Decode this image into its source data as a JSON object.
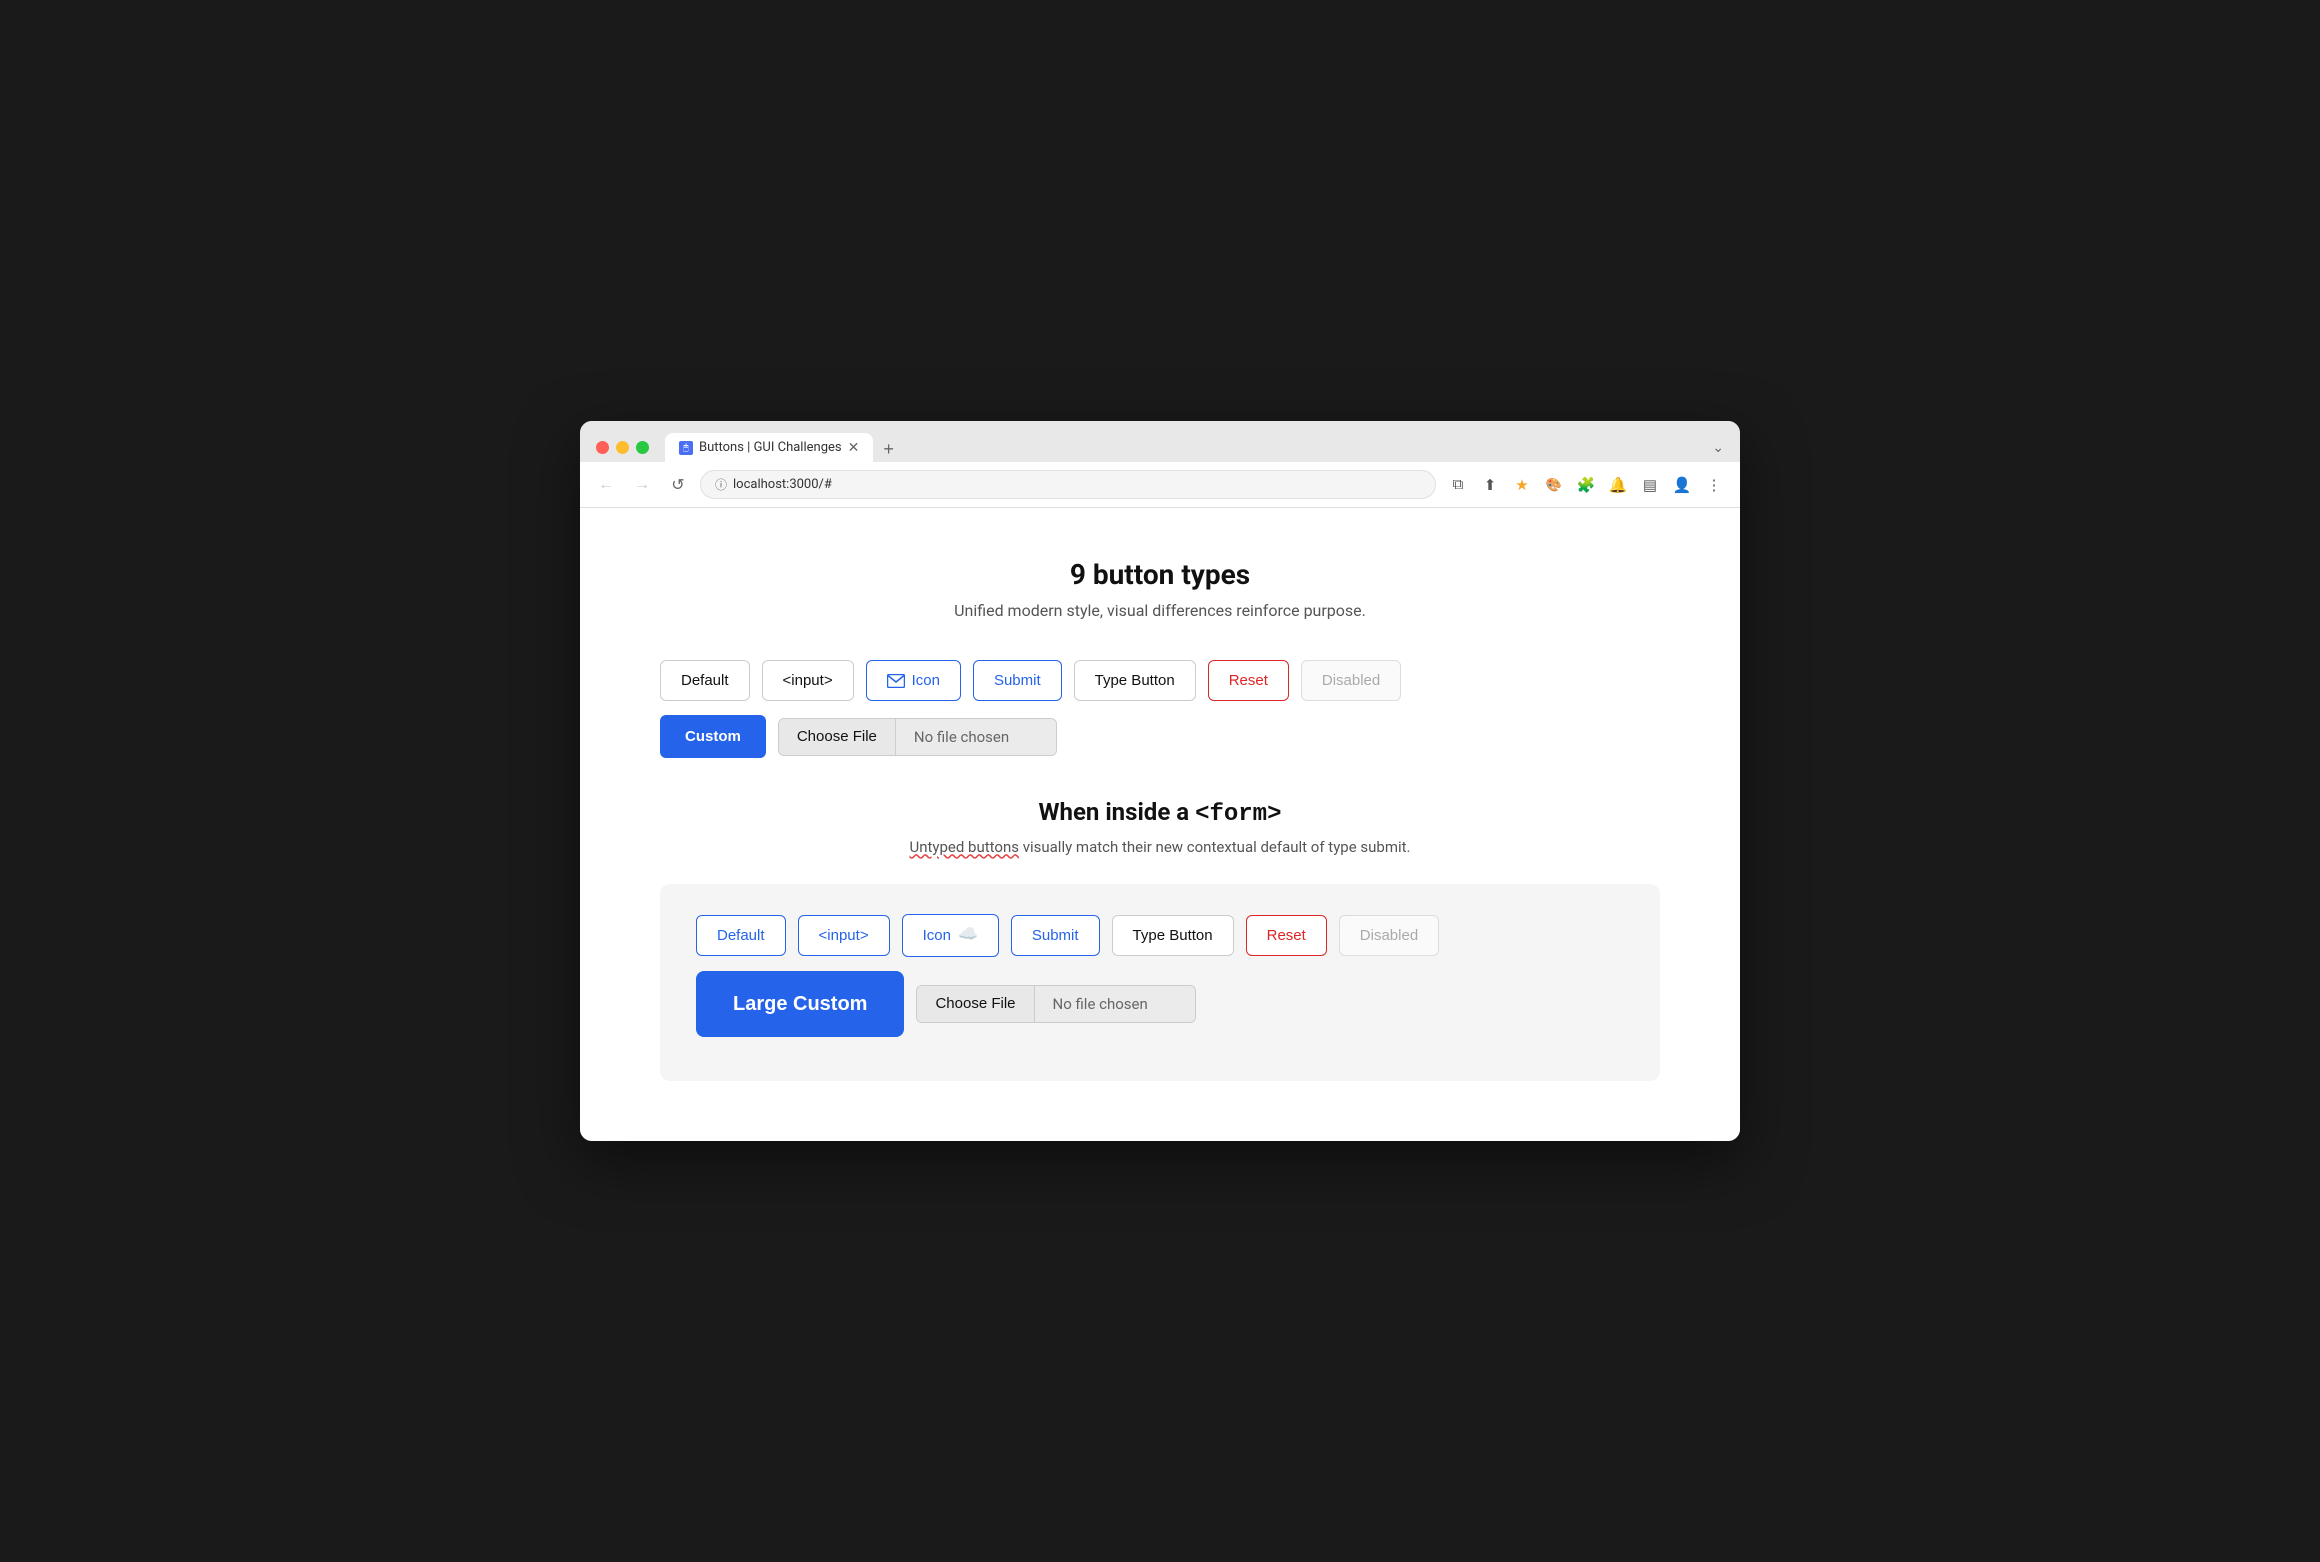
{
  "browser": {
    "tab_title": "Buttons | GUI Challenges",
    "address": "localhost:3000/#",
    "new_tab_label": "+",
    "nav": {
      "back": "←",
      "forward": "→",
      "reload": "↺"
    }
  },
  "page": {
    "title": "9 button types",
    "subtitle": "Unified modern style, visual differences reinforce purpose."
  },
  "section1": {
    "buttons": {
      "default": "Default",
      "input": "<input>",
      "icon": "Icon",
      "submit": "Submit",
      "type_button": "Type Button",
      "reset": "Reset",
      "disabled": "Disabled",
      "custom": "Custom",
      "file_choose": "Choose File",
      "file_no_chosen": "No file chosen"
    }
  },
  "section2": {
    "title_text": "When inside a ",
    "title_code": "<form>",
    "subtitle_normal": " visually match their new contextual default of type submit.",
    "subtitle_underlined": "Untyped buttons",
    "buttons": {
      "default": "Default",
      "input": "<input>",
      "icon": "Icon",
      "submit": "Submit",
      "type_button": "Type Button",
      "reset": "Reset",
      "disabled": "Disabled",
      "large_custom": "Large Custom",
      "file_choose": "Choose File",
      "file_no_chosen": "No file chosen"
    }
  }
}
